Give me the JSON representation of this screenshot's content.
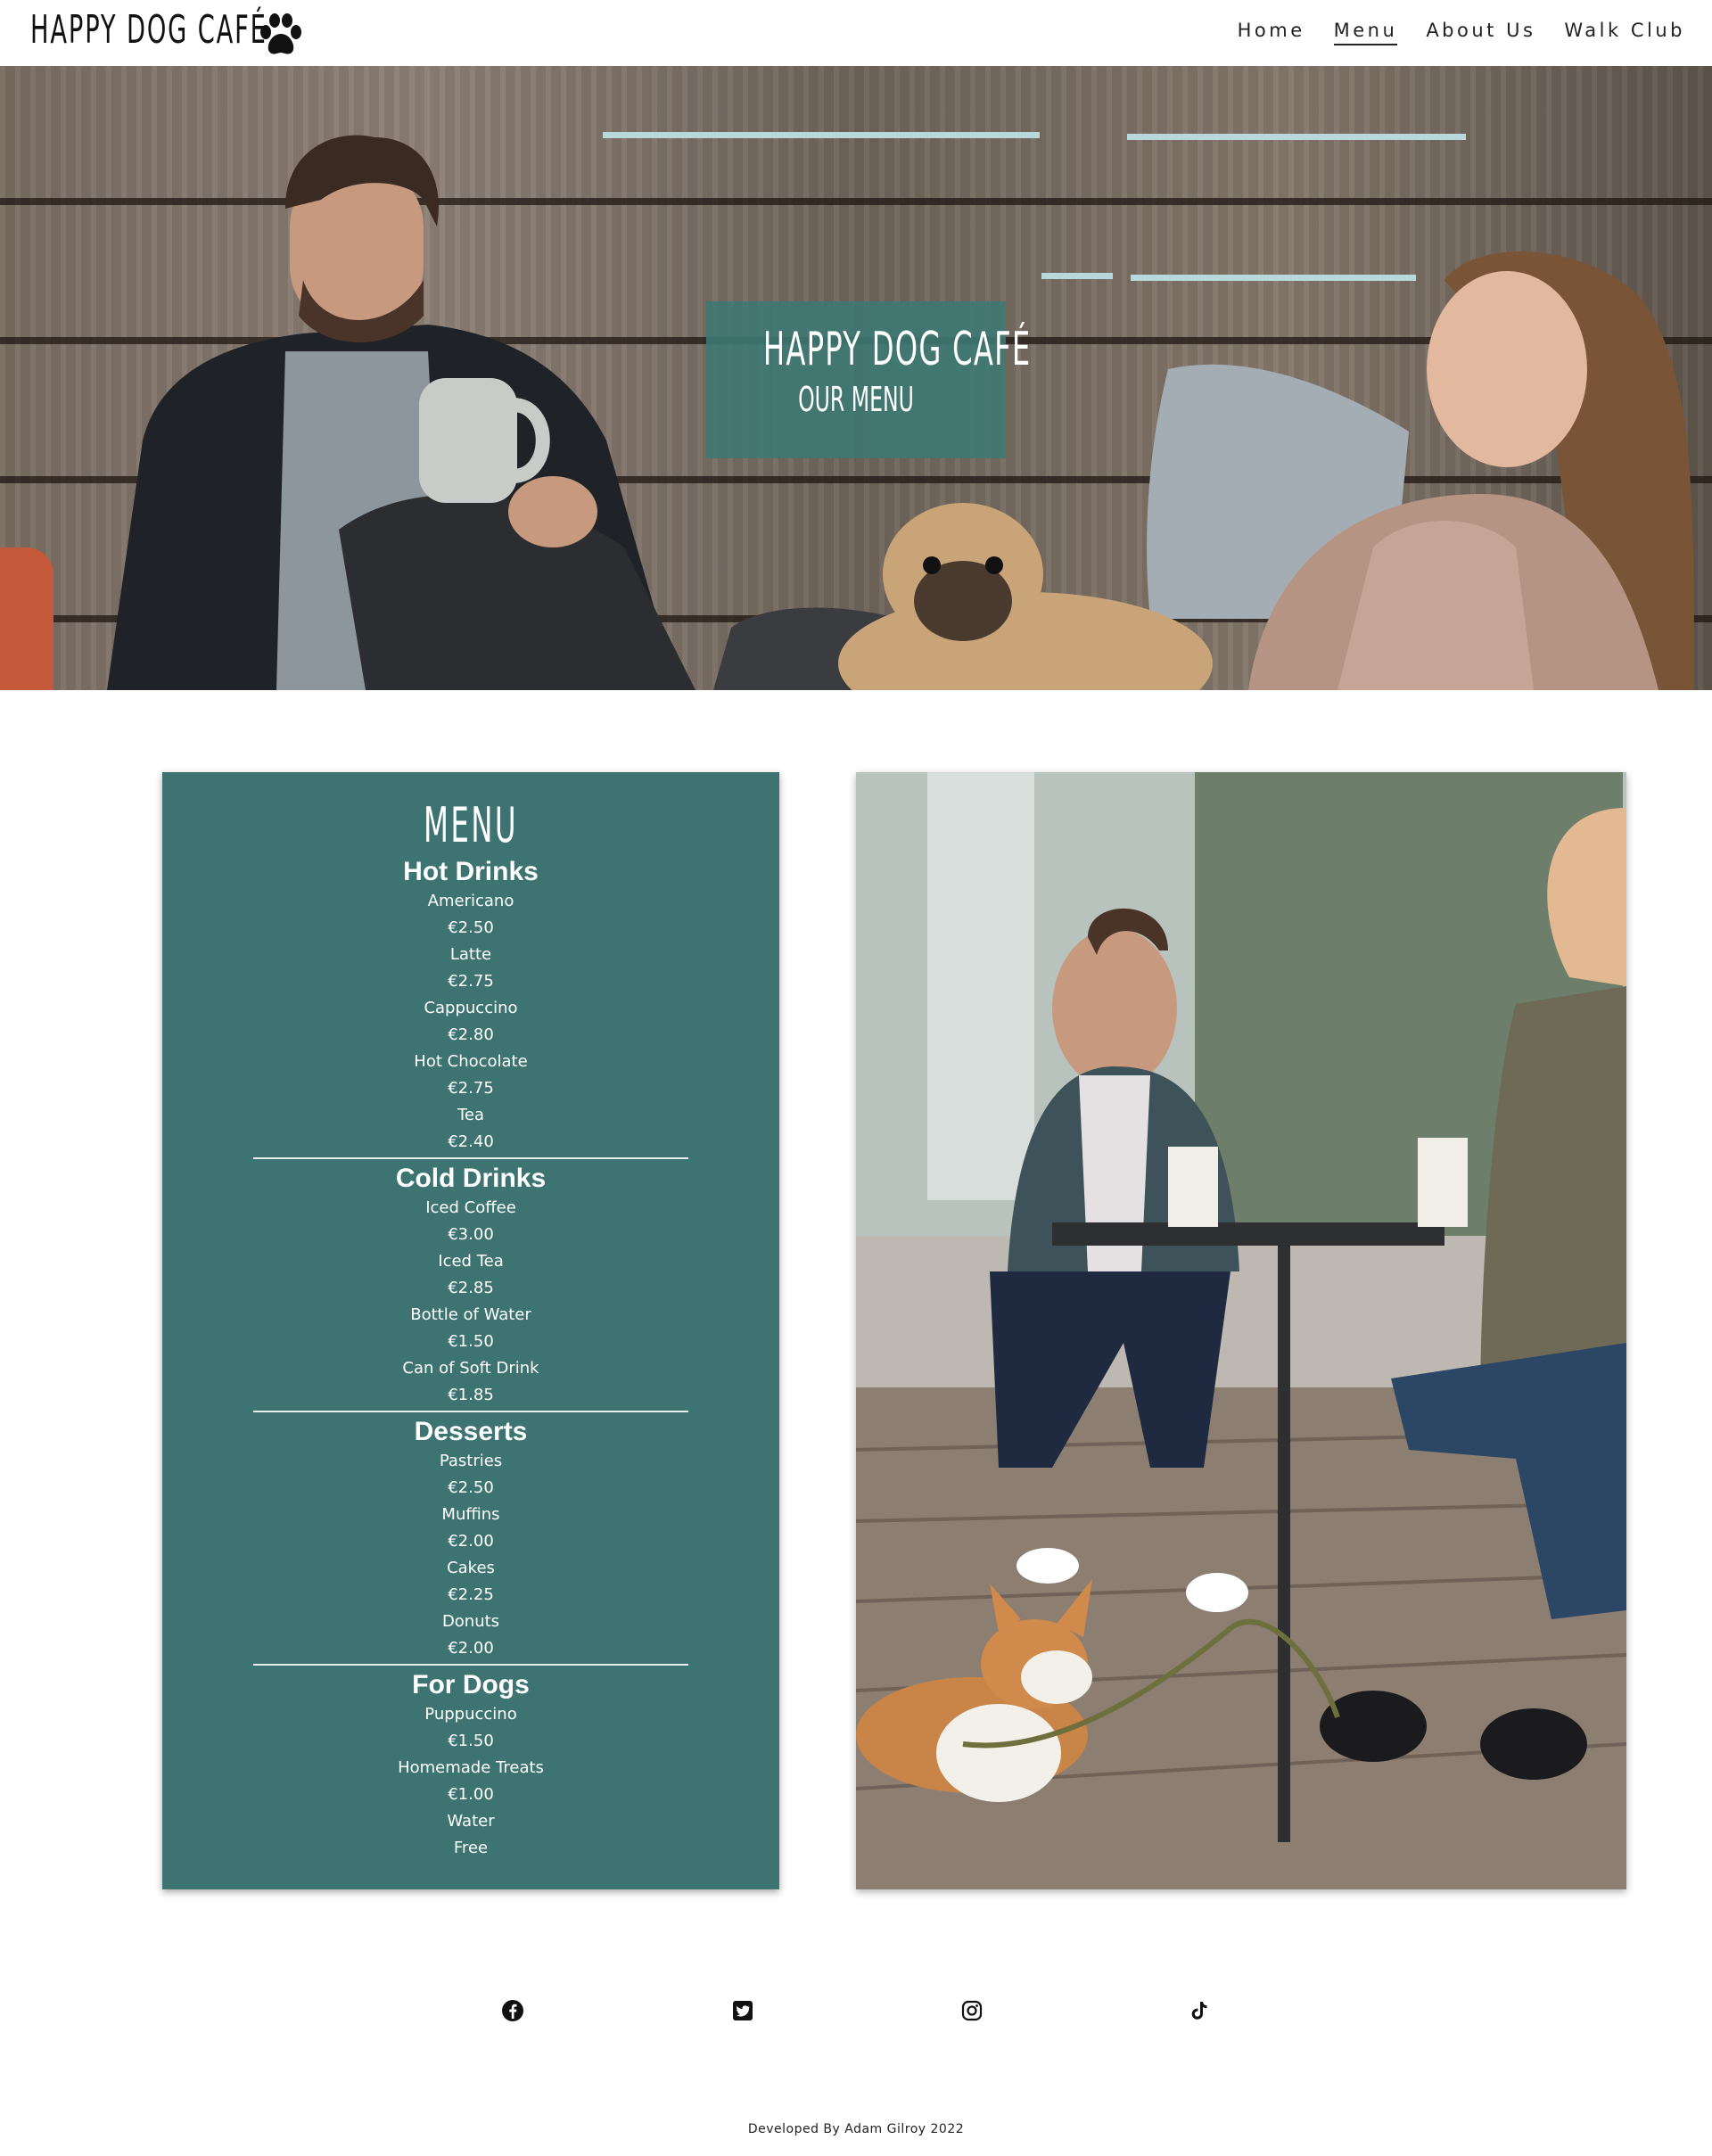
{
  "header": {
    "logo_text": "HAPPY DOG CAFÉ",
    "nav": [
      {
        "label": "Home",
        "active": false
      },
      {
        "label": "Menu",
        "active": true
      },
      {
        "label": "About Us",
        "active": false
      },
      {
        "label": "Walk Club",
        "active": false
      }
    ]
  },
  "hero": {
    "title": "HAPPY DOG CAFÉ",
    "subtitle": "OUR MENU"
  },
  "menu": {
    "heading": "MENU",
    "sections": [
      {
        "title": "Hot Drinks",
        "items": [
          {
            "name": "Americano",
            "price": "€2.50"
          },
          {
            "name": "Latte",
            "price": "€2.75"
          },
          {
            "name": "Cappuccino",
            "price": "€2.80"
          },
          {
            "name": "Hot Chocolate",
            "price": "€2.75"
          },
          {
            "name": "Tea",
            "price": "€2.40"
          }
        ]
      },
      {
        "title": "Cold Drinks",
        "items": [
          {
            "name": "Iced Coffee",
            "price": "€3.00"
          },
          {
            "name": "Iced Tea",
            "price": "€2.85"
          },
          {
            "name": "Bottle of Water",
            "price": "€1.50"
          },
          {
            "name": "Can of Soft Drink",
            "price": "€1.85"
          }
        ]
      },
      {
        "title": "Desserts",
        "items": [
          {
            "name": "Pastries",
            "price": "€2.50"
          },
          {
            "name": "Muffins",
            "price": "€2.00"
          },
          {
            "name": "Cakes",
            "price": "€2.25"
          },
          {
            "name": "Donuts",
            "price": "€2.00"
          }
        ]
      },
      {
        "title": "For Dogs",
        "items": [
          {
            "name": "Puppuccino",
            "price": "€1.50"
          },
          {
            "name": "Homemade Treats",
            "price": "€1.00"
          },
          {
            "name": "Water",
            "price": "Free"
          }
        ]
      }
    ]
  },
  "social": {
    "icons": [
      "facebook-icon",
      "twitter-icon",
      "instagram-icon",
      "tiktok-icon"
    ]
  },
  "footer": {
    "credit": "Developed By Adam Gilroy 2022"
  },
  "colors": {
    "accent": "#3d7471",
    "text": "#111111"
  }
}
